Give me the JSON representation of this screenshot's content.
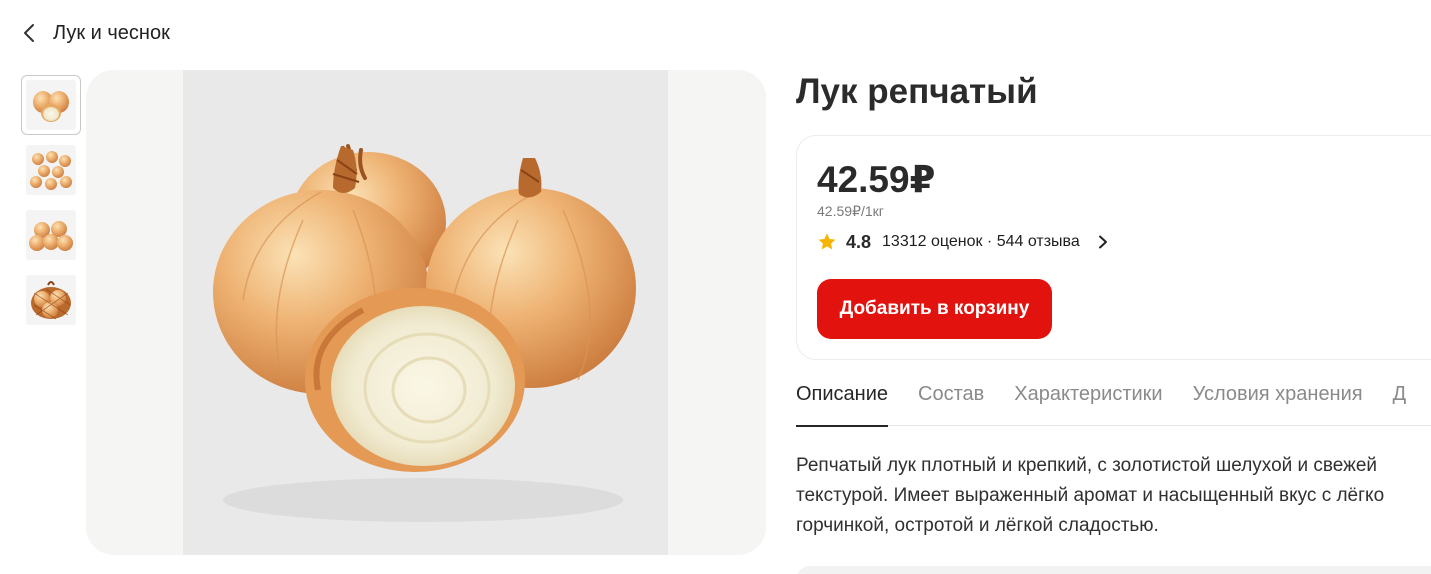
{
  "breadcrumb": {
    "label": "Лук и чеснок",
    "icon": "chevron-left-icon"
  },
  "product": {
    "title": "Лук репчатый",
    "price": "42.59₽",
    "unit_price": "42.59₽/1кг",
    "rating": {
      "score": "4.8",
      "summary": "13312 оценок · 544 отзыва",
      "icon": "star-icon",
      "star_color": "#f5b400"
    },
    "add_to_cart_label": "Добавить в корзину",
    "accent_color": "#e2130e"
  },
  "gallery": {
    "thumbnails": [
      {
        "name": "thumb-onion-half",
        "active": true
      },
      {
        "name": "thumb-onion-pile",
        "active": false
      },
      {
        "name": "thumb-onion-group",
        "active": false
      },
      {
        "name": "thumb-onion-net",
        "active": false
      }
    ]
  },
  "tabs": [
    {
      "label": "Описание",
      "active": true
    },
    {
      "label": "Состав",
      "active": false
    },
    {
      "label": "Характеристики",
      "active": false
    },
    {
      "label": "Условия хранения",
      "active": false
    },
    {
      "label": "Д",
      "active": false
    }
  ],
  "description": {
    "lines": [
      "Репчатый лук плотный и крепкий, с золотистой шелухой и свежей",
      "текстурой. Имеет выраженный аромат и насыщенный вкус с лёгко",
      "горчинкой, остротой и лёгкой сладостью."
    ]
  }
}
